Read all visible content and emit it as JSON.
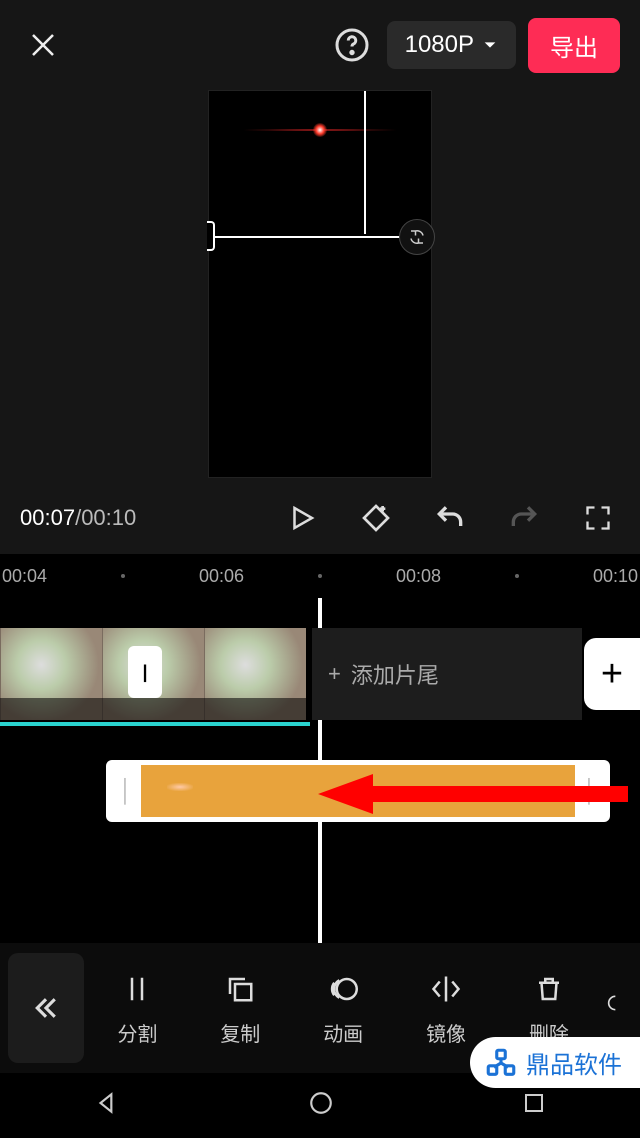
{
  "header": {
    "resolution_label": "1080P",
    "export_label": "导出"
  },
  "transport": {
    "time_current": "00:07",
    "time_separator": "/",
    "time_total": "00:10"
  },
  "ruler": {
    "marks": [
      "00:04",
      "00:06",
      "00:08",
      "00:10"
    ]
  },
  "timeline": {
    "add_tail_label": "添加片尾",
    "add_clip_label": "+",
    "transition_label": "|"
  },
  "tools": {
    "split": "分割",
    "copy": "复制",
    "anim": "动画",
    "mirror": "镜像",
    "delete": "删除"
  },
  "watermark": {
    "text": "鼎品软件"
  }
}
